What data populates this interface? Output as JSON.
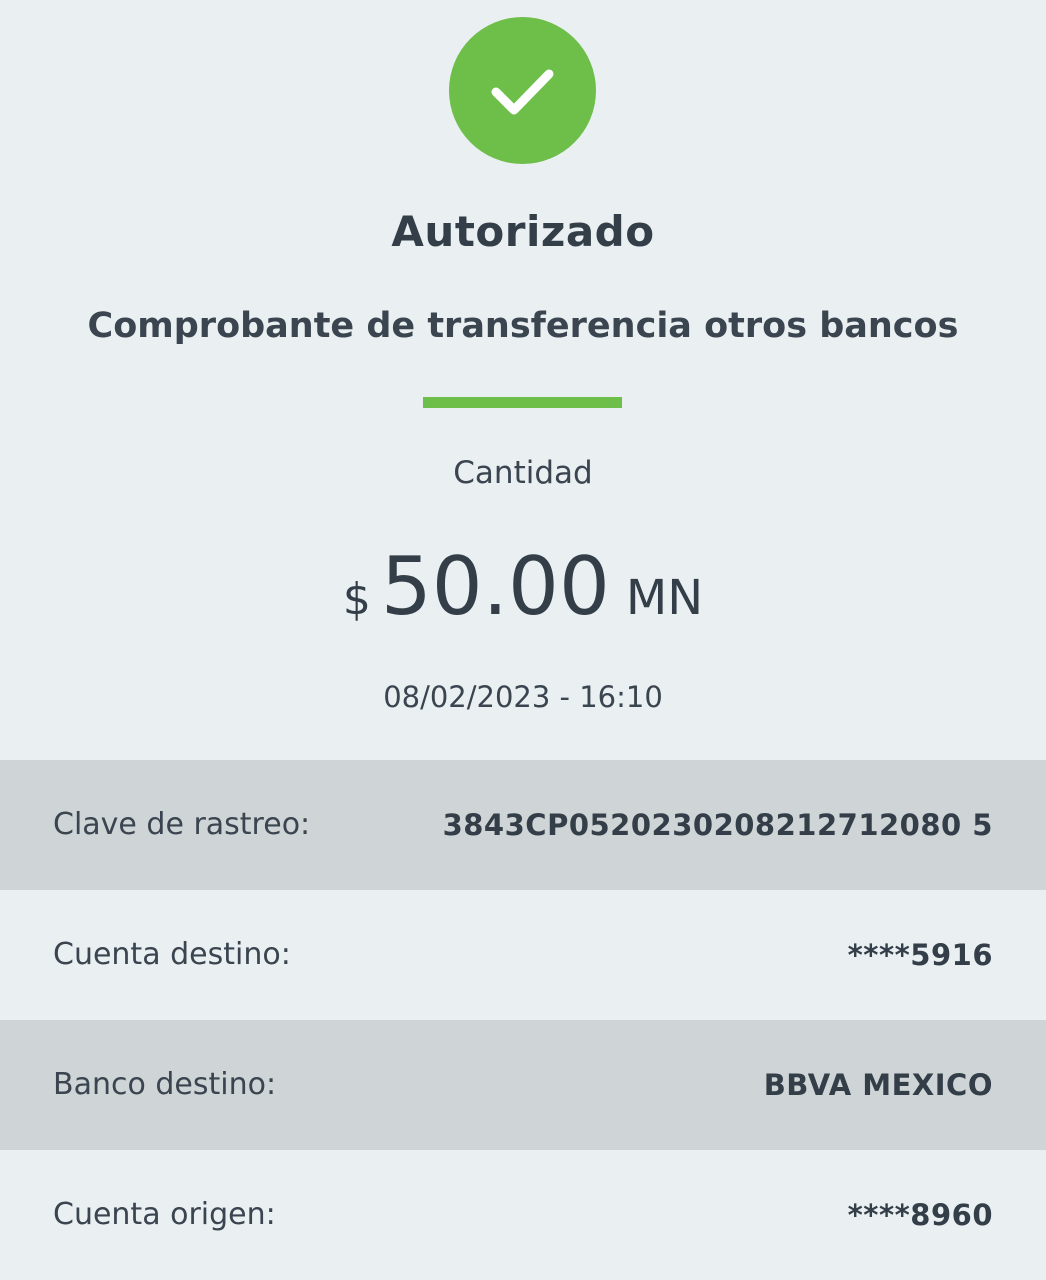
{
  "status": {
    "title": "Autorizado",
    "icon": "check-icon",
    "color": "#6dbf4a"
  },
  "receipt": {
    "subtitle": "Comprobante de transferencia otros bancos"
  },
  "amount": {
    "label": "Cantidad",
    "symbol": "$",
    "value": "50.00",
    "currency": "MN"
  },
  "datetime": "08/02/2023 - 16:10",
  "details": [
    {
      "label": "Clave de rastreo:",
      "value": "3843CP0520230208212712080 5"
    },
    {
      "label": "Cuenta destino:",
      "value": "****5916"
    },
    {
      "label": "Banco destino:",
      "value": "BBVA MEXICO"
    },
    {
      "label": "Cuenta origen:",
      "value": "****8960"
    }
  ]
}
